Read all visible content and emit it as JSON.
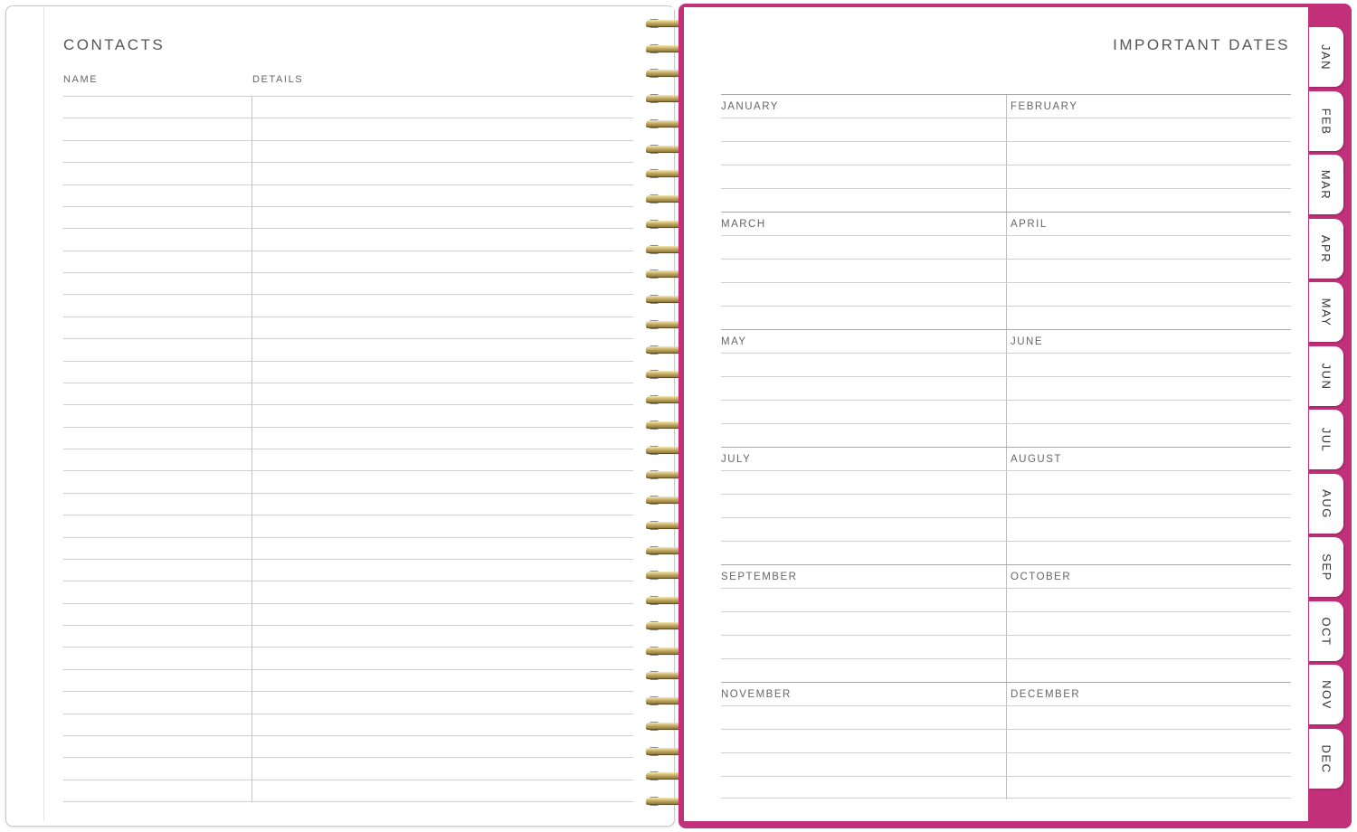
{
  "contacts": {
    "title": "CONTACTS",
    "columns": [
      "NAME",
      "DETAILS"
    ]
  },
  "important_dates": {
    "title": "IMPORTANT DATES",
    "months": [
      "JANUARY",
      "FEBRUARY",
      "MARCH",
      "APRIL",
      "MAY",
      "JUNE",
      "JULY",
      "AUGUST",
      "SEPTEMBER",
      "OCTOBER",
      "NOVEMBER",
      "DECEMBER"
    ]
  },
  "tabs": [
    "JAN",
    "FEB",
    "MAR",
    "APR",
    "MAY",
    "JUN",
    "JUL",
    "AUG",
    "SEP",
    "OCT",
    "NOV",
    "DEC"
  ],
  "colors": {
    "cover": "#c2307a",
    "rule": "#cfcfcf",
    "text": "#555555",
    "spiral": "#c9b069"
  }
}
